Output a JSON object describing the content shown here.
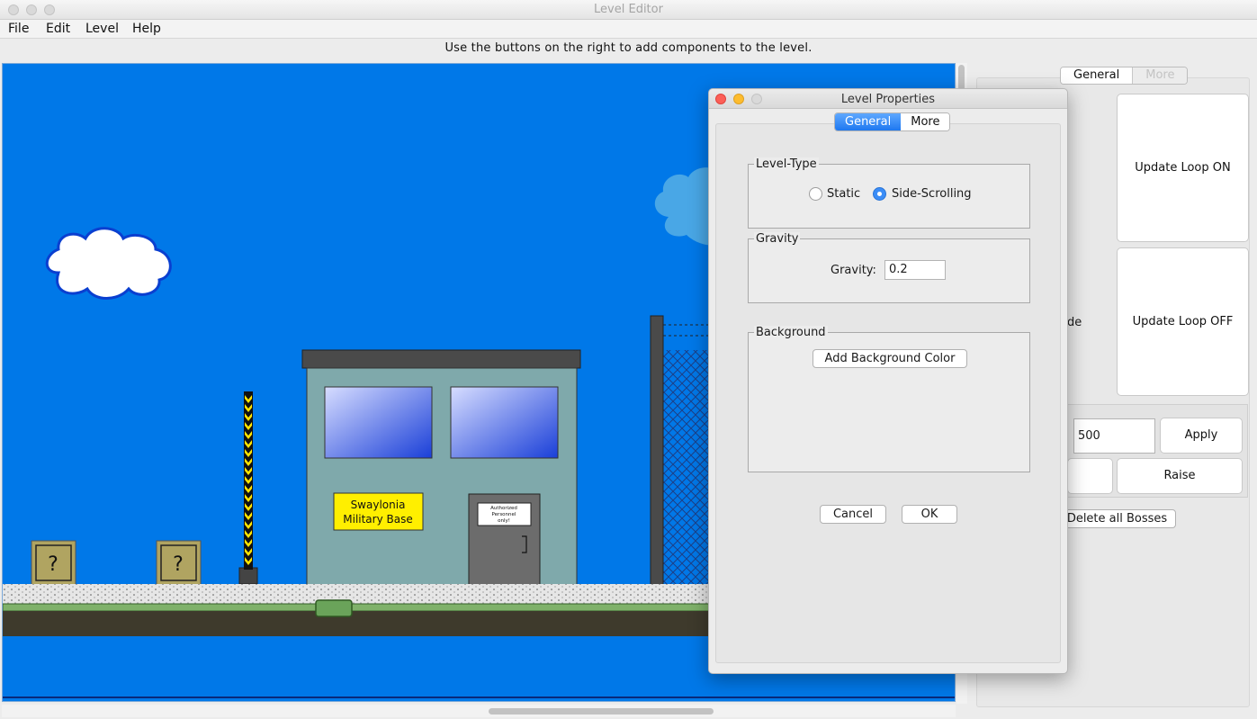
{
  "window": {
    "title": "Level Editor"
  },
  "menu": [
    "File",
    "Edit",
    "Level",
    "Help"
  ],
  "hint": "Use the buttons on the right to add components to the level.",
  "scene": {
    "sign_line1": "Swaylonia",
    "sign_line2": "Military Base",
    "door_sign": [
      "Authorized",
      "Personnel",
      "only!"
    ],
    "block_glyph": "?"
  },
  "right_panel": {
    "tabs": [
      "General",
      "More"
    ],
    "update_loop_on": "Update Loop ON",
    "update_loop_off": "Update Loop OFF",
    "partial_label": "de",
    "value_field": "500",
    "apply": "Apply",
    "raise": "Raise",
    "delete_bosses": "Delete all Bosses"
  },
  "dialog": {
    "title": "Level Properties",
    "tabs": [
      "General",
      "More"
    ],
    "level_type": {
      "title": "Level-Type",
      "options": [
        "Static",
        "Side-Scrolling"
      ],
      "selected": "Side-Scrolling"
    },
    "gravity": {
      "title": "Gravity",
      "label": "Gravity:",
      "value": "0.2"
    },
    "background": {
      "title": "Background",
      "add_color": "Add Background Color"
    },
    "cancel": "Cancel",
    "ok": "OK"
  },
  "colors": {
    "sky": "#0078e8",
    "building": "#7fa9ab",
    "sign": "#ffef00",
    "accent": "#1e78f0",
    "close": "#fc5f57",
    "minimize": "#fdbc2e"
  }
}
